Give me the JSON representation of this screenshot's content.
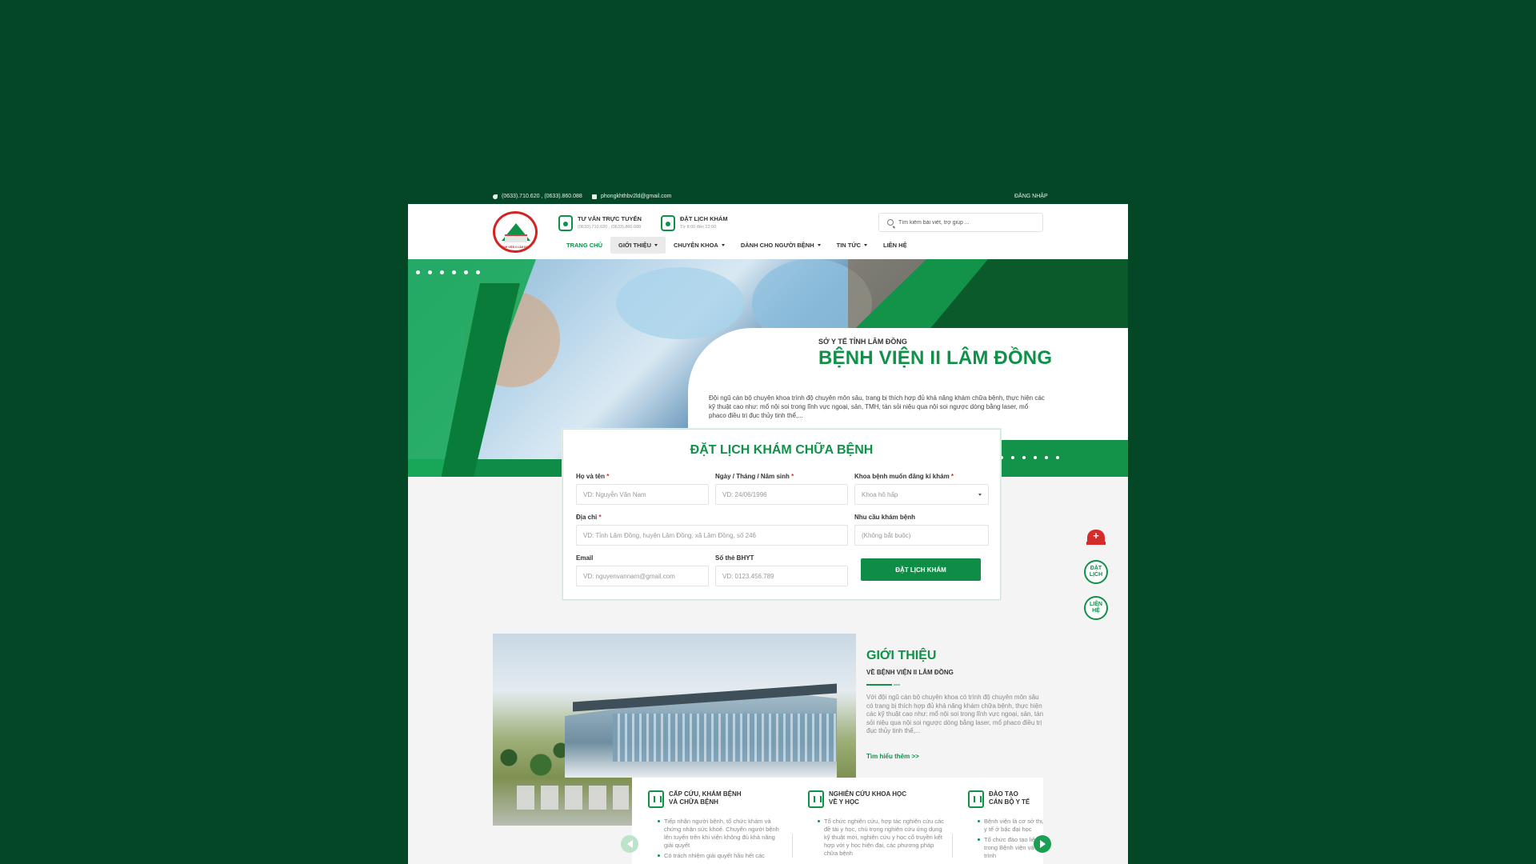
{
  "topbar": {
    "phone": "(0633).710.620 , (0633).860.088",
    "email": "phongkhthbv2ld@gmail.com",
    "login": "ĐĂNG NHẬP"
  },
  "header": {
    "logo_text": "BỆNH VIỆN II LÂM ĐỒNG",
    "services": [
      {
        "title": "TƯ VẤN TRỰC TUYẾN",
        "sub": "(0633).710.620 , (0633).860.088",
        "icon": "doctor-icon"
      },
      {
        "title": "ĐẶT LỊCH KHÁM",
        "sub": "Từ 8:00 đến 22:00",
        "icon": "calendar-icon"
      }
    ],
    "search_placeholder": "Tìm kiếm bài viết, trợ giúp ..."
  },
  "nav": [
    {
      "label": "TRANG CHỦ",
      "active": true,
      "dropdown": false
    },
    {
      "label": "GIỚI THIỆU",
      "active": false,
      "dropdown": true
    },
    {
      "label": "CHUYÊN KHOA",
      "active": false,
      "dropdown": true
    },
    {
      "label": "DÀNH CHO NGƯỜI BỆNH",
      "active": false,
      "dropdown": true
    },
    {
      "label": "TIN TỨC",
      "active": false,
      "dropdown": true
    },
    {
      "label": "LIÊN HỆ",
      "active": false,
      "dropdown": false
    }
  ],
  "hero": {
    "subtitle": "SỞ Y TẾ TỈNH LÂM ĐỒNG",
    "title": "BỆNH VIỆN II LÂM ĐỒNG",
    "description": "Đội ngũ cán bộ chuyên khoa trình độ chuyên môn sâu, trang bị thích hợp đủ khả năng khám chữa bệnh, thực hiện các kỹ thuật cao như: mổ nội soi trong lĩnh vực ngoại, sản, TMH, tán sỏi niệu qua nội soi ngược dòng bằng laser, mổ phaco điều trị đục thủy tinh thể,..."
  },
  "float_buttons": {
    "book": "ĐẶT LỊCH",
    "contact": "LIÊN HỆ"
  },
  "booking": {
    "title": "ĐẶT LỊCH KHÁM CHỮA BỆNH",
    "fields": {
      "name": {
        "label": "Họ và tên",
        "placeholder": "VD: Nguyễn Văn Nam",
        "required": "*"
      },
      "dob": {
        "label": "Ngày / Tháng / Năm sinh",
        "placeholder": "VD: 24/06/1996",
        "required": "*"
      },
      "dept": {
        "label": "Khoa bệnh muốn đăng kí khám",
        "value": "Khoa hô hấp",
        "required": "*"
      },
      "address": {
        "label": "Địa chỉ",
        "placeholder": "VD: Tỉnh Lâm Đồng, huyện Lâm Đồng, xã Lâm Đồng, số 246",
        "required": "*"
      },
      "need": {
        "label": "Nhu cầu khám bệnh",
        "placeholder": "(Không bắt buộc)"
      },
      "email": {
        "label": "Email",
        "placeholder": "VD: nguyenvannam@gmail.com"
      },
      "bhyt": {
        "label": "Số thẻ BHYT",
        "placeholder": "VD: 0123.456.789"
      }
    },
    "submit": "ĐẶT LỊCH KHÁM"
  },
  "intro": {
    "title": "GIỚI THIỆU",
    "subtitle": "VỀ BỆNH VIỆN II LÂM ĐỒNG",
    "text": "Với đội ngũ cán bộ chuyên khoa có trình độ chuyên môn sâu có trang bị thích hợp đủ khả năng khám chữa bệnh, thực hiện các kỹ thuật cao như: mổ nội soi trong lĩnh vực ngoại, sản, tán sỏi niệu qua nội soi ngược dòng bằng laser, mổ phaco điều trị đục thủy tinh thể,...",
    "more": "Tìm hiểu thêm  >>"
  },
  "cards": [
    {
      "title": "CẤP CỨU, KHÁM BỆNH\nVÀ CHỮA BỆNH",
      "items": [
        "Tiếp nhận người bệnh, tổ chức khám và chứng nhận sức khoẻ. Chuyển người bệnh lên tuyến trên khi viện không đủ khả năng giải quyết",
        "Có trách nhiệm giải quyết hầu hết các"
      ]
    },
    {
      "title": "NGHIÊN CỨU KHOA HỌC\nVỀ Y HỌC",
      "items": [
        "Tổ chức nghiên cứu, hợp tác nghiên cứu các đề tài y học, chú trọng nghiên cứu ứng dụng kỹ thuật mới, nghiên cứu y học cổ truyền kết hợp với y học hiện đại, các phương pháp chữa bệnh"
      ]
    },
    {
      "title": "ĐÀO TẠO\nCÁN BỘ Y TẾ",
      "items": [
        "Bệnh viện là cơ sở thực hành đào tạo cán bộ y tế ở bậc đại học",
        "Tổ chức đào tạo liên tục cho các thành viên trong Bệnh viện và tuyến dưới để nâng cấp trình"
      ]
    }
  ]
}
